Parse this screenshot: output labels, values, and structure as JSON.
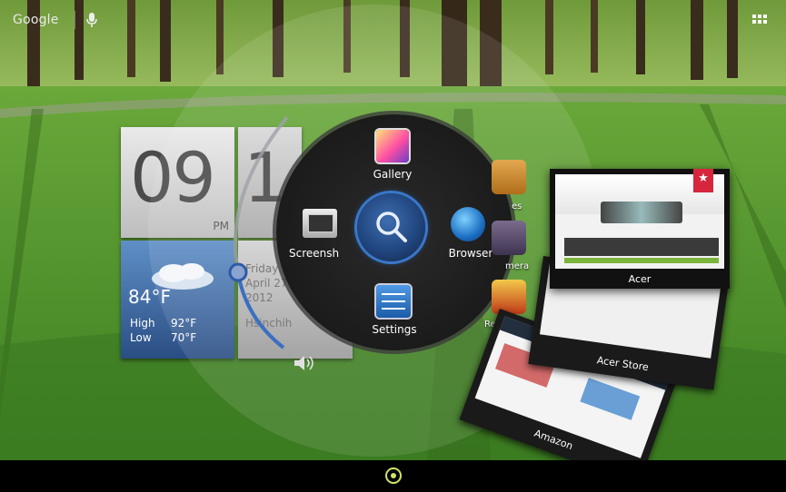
{
  "status_bar": {
    "search_label": "Google",
    "voice_icon": "microphone-icon",
    "apps_icon": "grid-icon"
  },
  "clock": {
    "hours": "09",
    "minutes": "1",
    "ampm": "PM"
  },
  "weather": {
    "temp": "84°F",
    "high_label": "High",
    "high_value": "92°F",
    "low_label": "Low",
    "low_value": "70°F"
  },
  "date": {
    "line1": "Friday",
    "line2": "April 27",
    "line3": "2012",
    "location": "Hsinchih"
  },
  "ring_menu": {
    "top": "Gallery",
    "left": "Screensh",
    "right": "Browser",
    "bottom": "Settings",
    "center_icon": "search-icon"
  },
  "apps": [
    {
      "label": "es"
    },
    {
      "label": "mera"
    },
    {
      "label": "Real Racin"
    }
  ],
  "recent": {
    "acer": "Acer",
    "acer_store": "Acer Store",
    "amazon": "Amazon"
  },
  "colors": {
    "accent": "#3978c8",
    "home_dot": "#cfe46a"
  }
}
